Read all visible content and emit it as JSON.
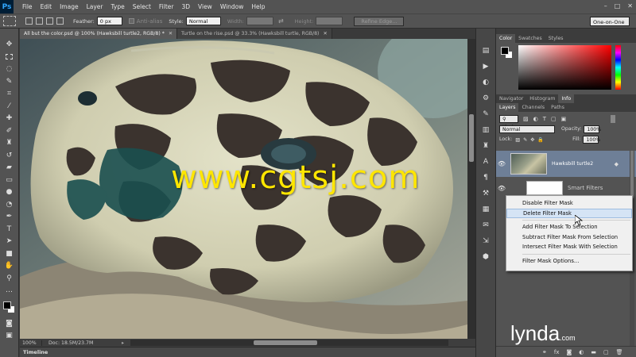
{
  "app": {
    "logo": "Ps"
  },
  "menu": [
    "File",
    "Edit",
    "Image",
    "Layer",
    "Type",
    "Select",
    "Filter",
    "3D",
    "View",
    "Window",
    "Help"
  ],
  "window_controls": {
    "minimize": "–",
    "restore": "□",
    "close": "✕"
  },
  "options_bar": {
    "feather_label": "Feather:",
    "feather_value": "0 px",
    "antialias_label": "Anti-alias",
    "style_label": "Style:",
    "style_value": "Normal",
    "width_label": "Width:",
    "height_label": "Height:",
    "refine_edge": "Refine Edge...",
    "workspace": "One-on-One"
  },
  "document_tabs": [
    {
      "label": "All but the color.psd @ 100% (Hawksbill turtle2, RGB/8) *",
      "active": true
    },
    {
      "label": "Turtle on the rise.psd @ 33.3% (Hawksbill turtle, RGB/8)",
      "active": false
    }
  ],
  "status_bar": {
    "zoom": "100%",
    "doc_info": "Doc: 18.5M/23.7M"
  },
  "timeline_label": "Timeline",
  "panels": {
    "color_tabs": [
      "Color",
      "Swatches",
      "Styles"
    ],
    "nav_tabs": [
      "Navigator",
      "Histogram",
      "Info"
    ],
    "layers_tabs": [
      "Layers",
      "Channels",
      "Paths"
    ],
    "filter_kind": "Kind",
    "blend_mode": "Normal",
    "opacity_label": "Opacity:",
    "opacity_value": "100%",
    "lock_label": "Lock:",
    "fill_label": "Fill:",
    "fill_value": "100%",
    "layer_name": "Hawksbill turtle2",
    "sublayer_label": "Smart Filters"
  },
  "context_menu": {
    "items": [
      "Disable Filter Mask",
      "Delete Filter Mask",
      "Add Filter Mask To Selection",
      "Subtract Filter Mask From Selection",
      "Intersect Filter Mask With Selection",
      "Filter Mask Options..."
    ],
    "hover_index": 1
  },
  "watermarks": {
    "center": "www.cgtsj.com",
    "brand": "lynda",
    "brand_suffix": ".com"
  }
}
